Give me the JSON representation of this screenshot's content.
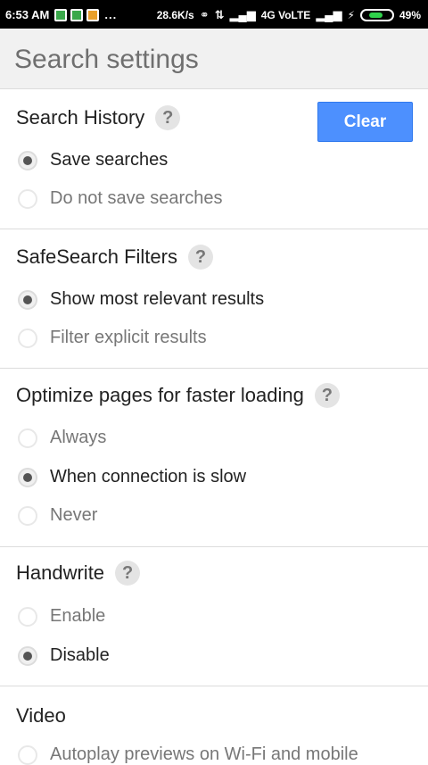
{
  "status_bar": {
    "time": "6:53 AM",
    "dots": "...",
    "speed": "28.6K/s",
    "network": "4G VoLTE",
    "battery": "49%",
    "battery_level": 0.49
  },
  "header": {
    "title": "Search settings"
  },
  "search_history": {
    "title": "Search History",
    "help": "?",
    "clear_label": "Clear",
    "options": [
      {
        "label": "Save searches",
        "selected": true
      },
      {
        "label": "Do not save searches",
        "selected": false
      }
    ]
  },
  "safesearch": {
    "title": "SafeSearch Filters",
    "help": "?",
    "options": [
      {
        "label": "Show most relevant results",
        "selected": true
      },
      {
        "label": "Filter explicit results",
        "selected": false
      }
    ]
  },
  "optimize": {
    "title": "Optimize pages for faster loading",
    "help": "?",
    "options": [
      {
        "label": "Always",
        "selected": false
      },
      {
        "label": "When connection is slow",
        "selected": true
      },
      {
        "label": "Never",
        "selected": false
      }
    ]
  },
  "handwrite": {
    "title": "Handwrite",
    "help": "?",
    "options": [
      {
        "label": "Enable",
        "selected": false
      },
      {
        "label": "Disable",
        "selected": true
      }
    ]
  },
  "video": {
    "title": "Video",
    "options": [
      {
        "label": "Autoplay previews on Wi-Fi and mobile",
        "selected": false
      }
    ]
  },
  "colors": {
    "accent": "#4d90fe",
    "header_bg": "#f1f1f1"
  }
}
